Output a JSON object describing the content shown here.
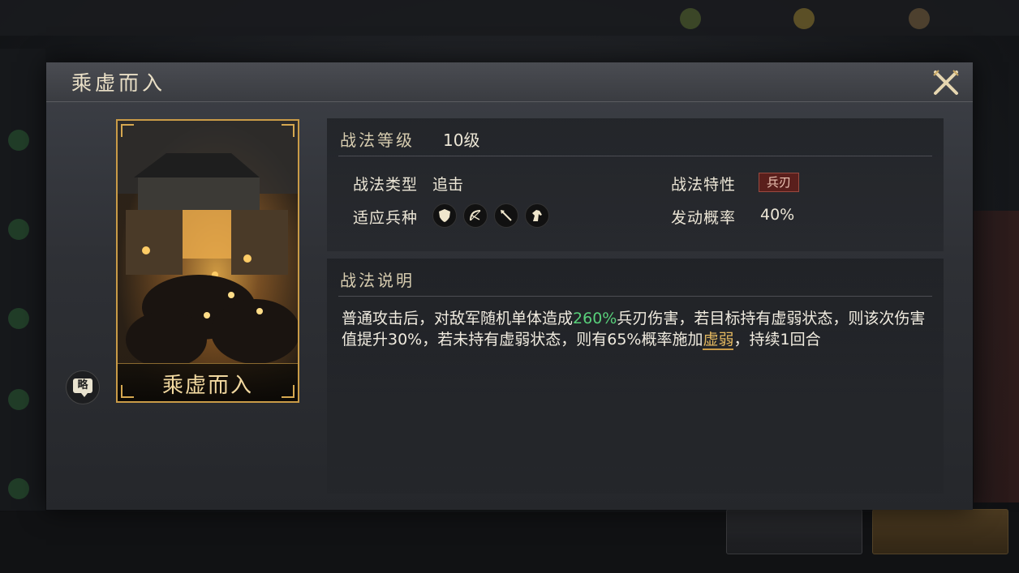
{
  "dialog": {
    "title": "乘虚而入",
    "close_icon": "close-x-icon"
  },
  "card": {
    "name": "乘虚而入",
    "art": "army-marching-into-city-gate-at-night",
    "brief_label": "略"
  },
  "info": {
    "section_title": "战法等级",
    "level": "10级",
    "type_label": "战法类型",
    "type_value": "追击",
    "troop_label": "适应兵种",
    "troop_icons": [
      "shield-icon",
      "bow-icon",
      "spear-icon",
      "horse-icon"
    ],
    "trait_label": "战法特性",
    "trait_value": "兵刃",
    "rate_label": "发动概率",
    "rate_value": "40%"
  },
  "description": {
    "section_title": "战法说明",
    "text_part1": "普通攻击后，对敌军随机单体造成",
    "text_green": "260%",
    "text_part2": "兵刃伤害，若目标持有虚弱状态，则该次伤害值提升30%，若未持有虚弱状态，则有65%概率施加",
    "text_link": "虚弱",
    "text_part3": "，持续1回合"
  },
  "colors": {
    "accent_gold": "#c99b47",
    "highlight_green": "#58d07a",
    "trait_red": "#5a1f1c"
  }
}
